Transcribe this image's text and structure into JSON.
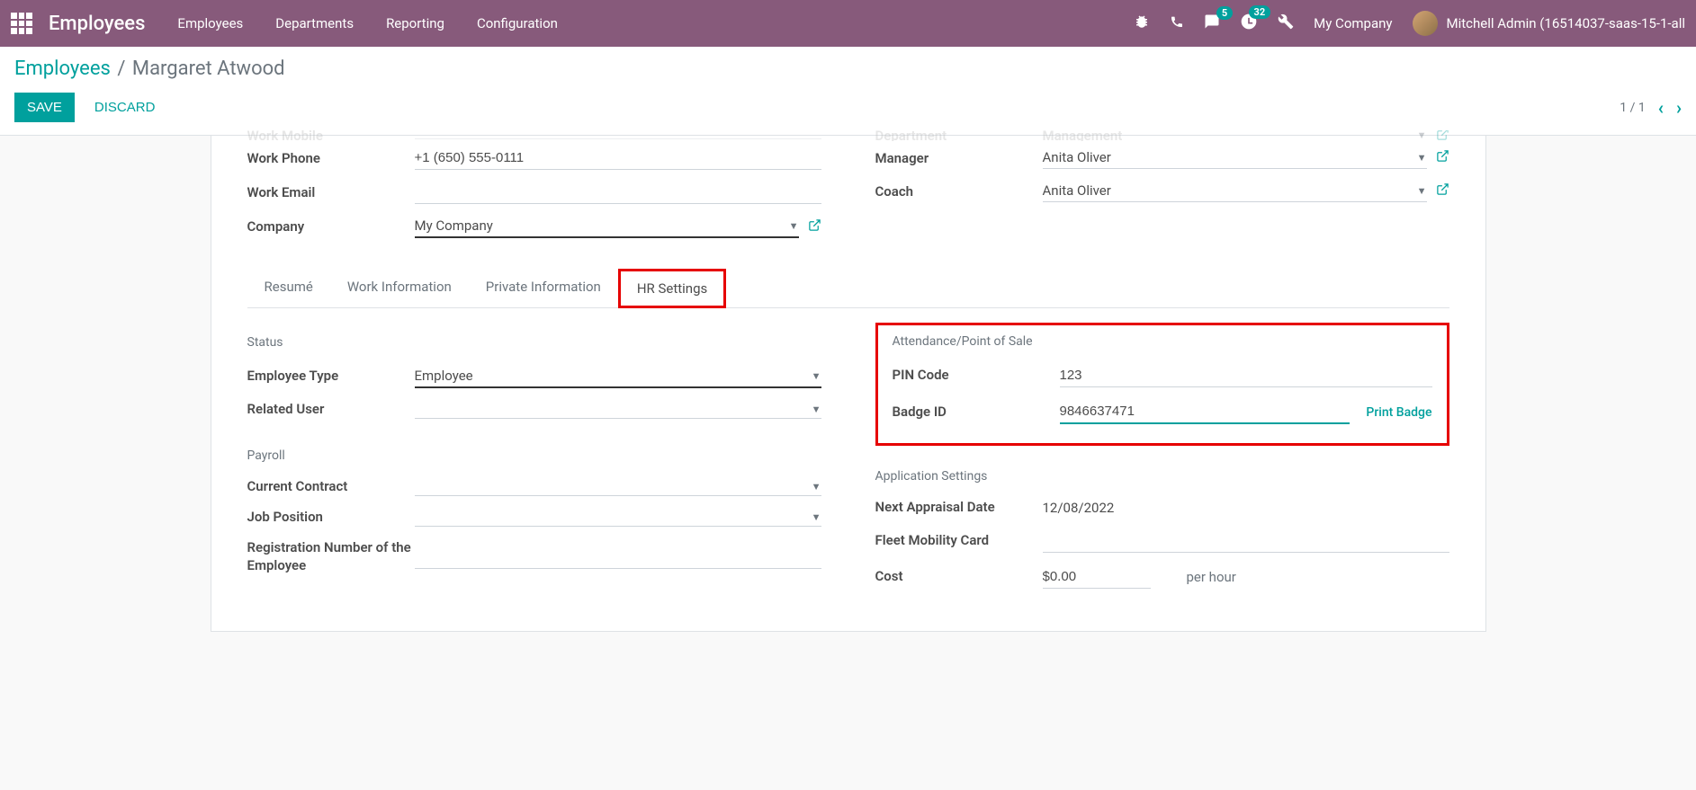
{
  "nav": {
    "brand": "Employees",
    "items": [
      "Employees",
      "Departments",
      "Reporting",
      "Configuration"
    ],
    "msg_badge": "5",
    "activity_badge": "32",
    "company": "My Company",
    "user": "Mitchell Admin (16514037-saas-15-1-all"
  },
  "breadcrumb": {
    "root": "Employees",
    "current": "Margaret Atwood"
  },
  "buttons": {
    "save": "SAVE",
    "discard": "DISCARD"
  },
  "pager": {
    "text": "1 / 1"
  },
  "top_fields": {
    "left": {
      "work_mobile_label": "Work Mobile",
      "work_phone_label": "Work Phone",
      "work_phone_value": "+1 (650) 555-0111",
      "work_email_label": "Work Email",
      "company_label": "Company",
      "company_value": "My Company"
    },
    "right": {
      "department_label": "Department",
      "department_value": "Management",
      "manager_label": "Manager",
      "manager_value": "Anita Oliver",
      "coach_label": "Coach",
      "coach_value": "Anita Oliver"
    }
  },
  "tabs": [
    "Resumé",
    "Work Information",
    "Private Information",
    "HR Settings"
  ],
  "hr": {
    "left": {
      "status_title": "Status",
      "employee_type_label": "Employee Type",
      "employee_type_value": "Employee",
      "related_user_label": "Related User",
      "payroll_title": "Payroll",
      "current_contract_label": "Current Contract",
      "job_position_label": "Job Position",
      "registration_label": "Registration Number of the Employee"
    },
    "right": {
      "attendance_title": "Attendance/Point of Sale",
      "pin_label": "PIN Code",
      "pin_value": "123",
      "badge_label": "Badge ID",
      "badge_value": "9846637471",
      "print_badge": "Print Badge",
      "app_settings_title": "Application Settings",
      "next_appraisal_label": "Next Appraisal Date",
      "next_appraisal_value": "12/08/2022",
      "fleet_label": "Fleet Mobility Card",
      "cost_label": "Cost",
      "cost_value": "$0.00",
      "per_hour": "per hour"
    }
  }
}
